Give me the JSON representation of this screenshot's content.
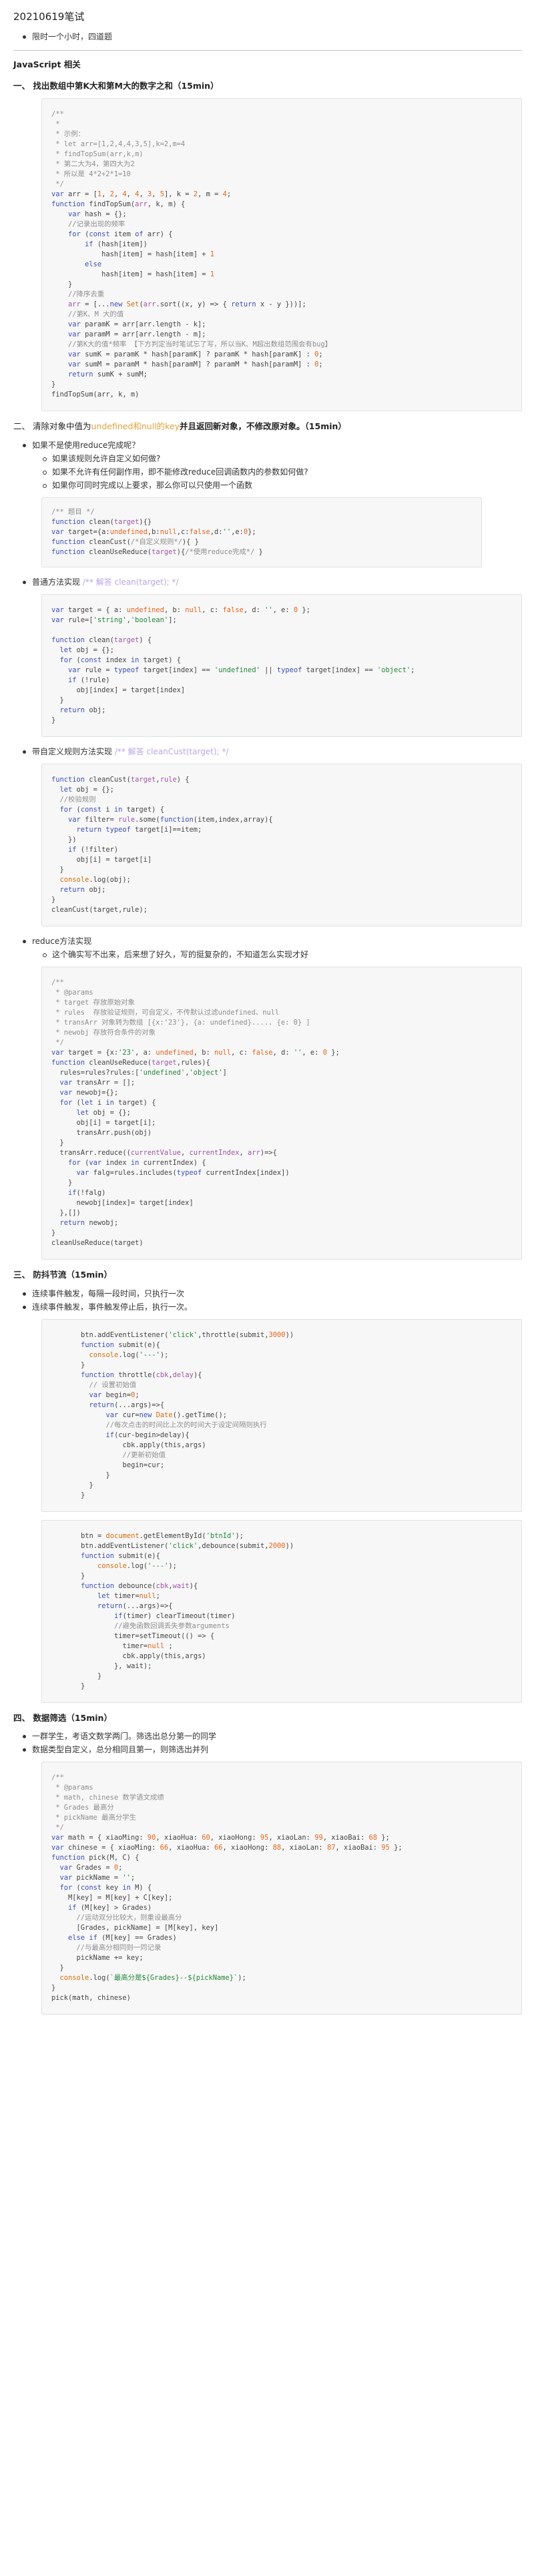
{
  "doc": {
    "title": "20210619笔试",
    "intro_bullets": [
      "限时一个小时，四道题"
    ],
    "category": "JavaScript 相关"
  },
  "sections": {
    "s1": {
      "title": "一、 找出数组中第K大和第M大的数字之和（15min）"
    },
    "s2": {
      "title_prefix": "二、 清除对象中值为",
      "title_code": "undefined和null的key",
      "title_suffix": "并且返回新对象，不修改原对象。（15min）",
      "bullets": [
        "如果不是使用reduce完成呢？"
      ],
      "sub_bullets": [
        "如果该规则允许自定义如何做?",
        "如果不允许有任何副作用，即不能修改reduce回调函数内的参数如何做?",
        "如果你可同时完成以上要求，那么你可以只使用一个函数"
      ],
      "label_normal": "普通方法实现",
      "label_normal_comment": "/** 解答 clean(target); */",
      "label_custom": "带自定义规则方法实现",
      "label_custom_comment": "/** 解答 cleanCust(target); */",
      "label_reduce": "reduce方法实现",
      "reduce_sub": [
        "这个确实写不出来，后来想了好久，写的挺复杂的，不知道怎么实现才好"
      ]
    },
    "s3": {
      "title": "三、 防抖节流（15min）",
      "bullets": [
        "连续事件触发，每隔一段时间，只执行一次",
        "连续事件触发，事件触发停止后，执行一次。"
      ]
    },
    "s4": {
      "title": "四、 数据筛选（15min）",
      "bullets": [
        "一群学生，考语文数学两门。筛选出总分第一的同学",
        "数据类型自定义，总分相同且第一，则筛选出并列"
      ]
    }
  },
  "code_blocks": {
    "c1": [
      "/**",
      " *",
      " * 示例：",
      " * let arr=[1,2,4,4,3,5],k=2,m=4",
      " * findTopSum(arr,k,m)",
      " * 第二大为4，第四大为2",
      " * 所以是 4*2+2*1=10",
      " */",
      "var arr = [1, 2, 4, 4, 3, 5], k = 2, m = 4;",
      "function findTopSum(arr, k, m) {",
      "    var hash = {};",
      "    //记录出现的频率",
      "    for (const item of arr) {",
      "        if (hash[item])",
      "            hash[item] = hash[item] + 1",
      "        else",
      "            hash[item] = hash[item] = 1",
      "    }",
      "    //降序去重",
      "    arr = [...new Set(arr.sort((x, y) => { return x - y }))];",
      "    //第K、M 大的值",
      "    var paramK = arr[arr.length - k];",
      "    var paramM = arr[arr.length - m];",
      "    //第K大的值*频率 【下方判定当时笔试忘了写，所以当K、M超出数组范围会有bug】",
      "    var sumK = paramK * hash[paramK] ? paramK * hash[paramK] : 0;",
      "    var sumM = paramM * hash[paramM] ? paramM * hash[paramM] : 0;",
      "    return sumK + sumM;",
      "}",
      "findTopSum(arr, k, m)"
    ],
    "c2": [
      "/** 题目 */",
      "function clean(target){}",
      "var target={a:undefined,b:null,c:false,d:'',e:0};",
      "function cleanCust(/*自定义规则*/){ }",
      "function cleanUseReduce(target){/*使用reduce完成*/ }"
    ],
    "c3": [
      "var target = { a: undefined, b: null, c: false, d: '', e: 0 };",
      "var rule=['string','boolean'];",
      "",
      "function clean(target) {",
      "  let obj = {};",
      "  for (const index in target) {",
      "    var rule = typeof target[index] == 'undefined' || typeof target[index] == 'object';",
      "    if (!rule)",
      "      obj[index] = target[index]",
      "  }",
      "  return obj;",
      "}"
    ],
    "c4": [
      "function cleanCust(target,rule) {",
      "  let obj = {};",
      "  //校验规则",
      "  for (const i in target) {",
      "    var filter= rule.some(function(item,index,array){",
      "      return typeof target[i]==item;",
      "    })",
      "    if (!filter)",
      "      obj[i] = target[i]",
      "  }",
      "  console.log(obj);",
      "  return obj;",
      "}",
      "cleanCust(target,rule);"
    ],
    "c5": [
      "/**",
      " * @params",
      " * target 存放原始对象",
      " * rules  存放验证规则，可自定义，不传默认过滤undefined、null",
      " * transArr 对象转为数组 [{x:'23'}, {a: undefined}..... {e: 0} ]",
      " * newobj 存放符合条件的对象",
      " */",
      "var target = {x:'23', a: undefined, b: null, c: false, d: '', e: 0 };",
      "function cleanUseReduce(target,rules){",
      "  rules=rules?rules:['undefined','object']",
      "  var transArr = [];",
      "  var newobj={};",
      "  for (let i in target) {",
      "      let obj = {};",
      "      obj[i] = target[i];",
      "      transArr.push(obj)",
      "  }",
      "  transArr.reduce((currentValue, currentIndex, arr)=>{",
      "    for (var index in currentIndex) {",
      "      var falg=rules.includes(typeof currentIndex[index])",
      "    }",
      "    if(!falg)",
      "      newobj[index]= target[index]",
      "  },[])",
      "  return newobj;",
      "}",
      "cleanUseReduce(target)"
    ],
    "c6": [
      "btn.addEventListener('click',throttle(submit,3000))",
      "function submit(e){",
      "  console.log('---');",
      "}",
      "function throttle(cbk,delay){",
      "  // 设置初始值",
      "  var begin=0;",
      "  return(...args)=>{",
      "      var cur=new Date().getTime();",
      "      //每次点击的时间比上次的时间大于设定间隔则执行",
      "      if(cur-begin>delay){",
      "          cbk.apply(this,args)",
      "          //更新初始值",
      "          begin=cur;",
      "      }",
      "  }",
      "}"
    ],
    "c7": [
      "btn = document.getElementById('btnId');",
      "btn.addEventListener('click',debounce(submit,2000))",
      "function submit(e){",
      "    console.log('---');",
      "}",
      "function debounce(cbk,wait){",
      "    let timer=null;",
      "    return(...args)=>{",
      "        if(timer) clearTimeout(timer)",
      "        //避免函数回调丢失参数arguments",
      "        timer=setTimeout(() => {",
      "          timer=null ;",
      "          cbk.apply(this,args)",
      "        }, wait);",
      "    }",
      "}"
    ],
    "c8": [
      "/**",
      " * @params",
      " * math, chinese 数学语文成绩",
      " * Grades 最高分",
      " * pickName 最高分学生",
      " */",
      "var math = { xiaoMing: 90, xiaoHua: 60, xiaoHong: 95, xiaoLan: 99, xiaoBai: 68 };",
      "var chinese = { xiaoMing: 66, xiaoHua: 66, xiaoHong: 88, xiaoLan: 87, xiaoBai: 95 };",
      "function pick(M, C) {",
      "  var Grades = 0;",
      "  var pickName = '';",
      "  for (const key in M) {",
      "    M[key] = M[key] + C[key];",
      "    if (M[key] > Grades)",
      "      //运动双分比较大，则重设最高分",
      "      [Grades, pickName] = [M[key], key]",
      "    else if (M[key] == Grades)",
      "      //与最高分相同则一同记录",
      "      pickName += key;",
      "  }",
      "  console.log(`最高分是${Grades}--${pickName}`);",
      "}",
      "pick(math, chinese)"
    ]
  }
}
